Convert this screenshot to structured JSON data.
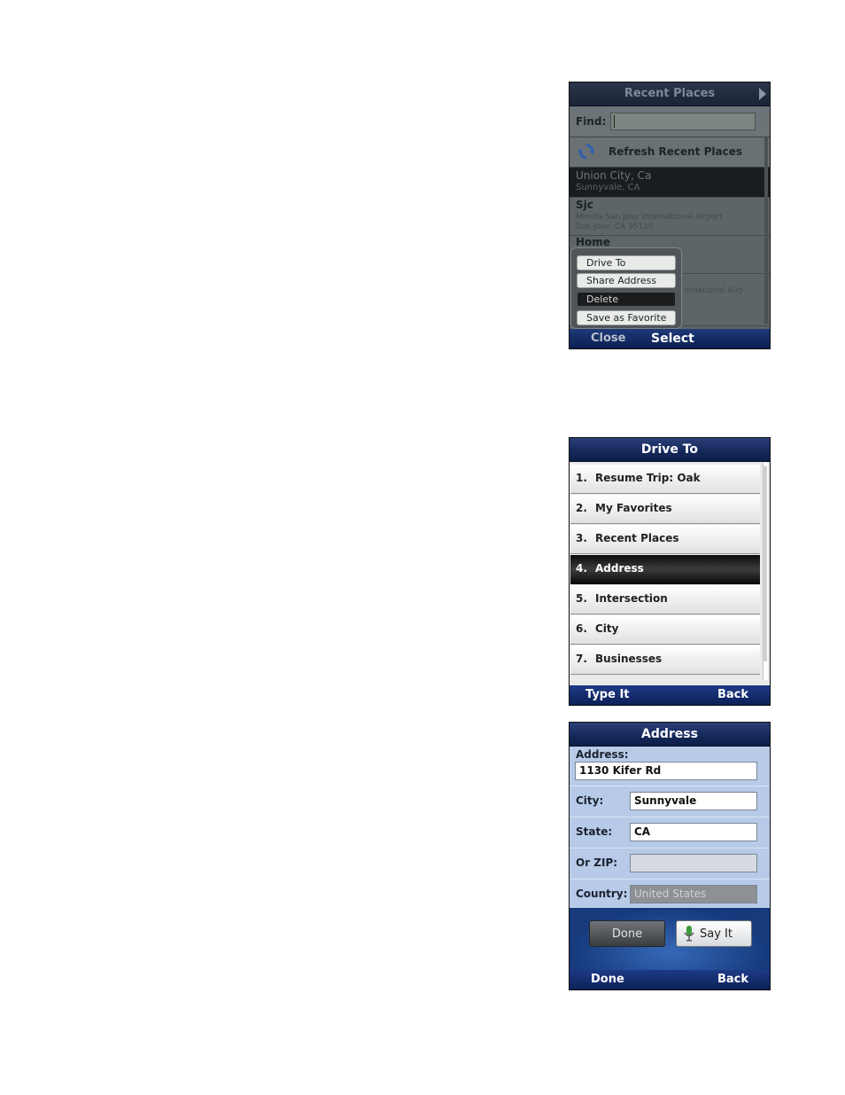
{
  "recent_places": {
    "title": "Recent Places",
    "find_label": "Find:",
    "find_value": "",
    "refresh_label": "Refresh Recent Places",
    "items": [
      {
        "title": "Union City, Ca",
        "sub1": "Sunnyvale, CA",
        "sub2": ""
      },
      {
        "title": "Sjc",
        "sub1": "Mineta San Jose International Airport",
        "sub2": "San Jose, CA 95110"
      },
      {
        "title": "Home",
        "sub1": "",
        "sub2": ""
      },
      {
        "title": "",
        "sub1": "ernational Airp..",
        "sub2": ""
      }
    ],
    "popup_options": [
      "Drive To",
      "Share Address",
      "Delete",
      "Save as Favorite"
    ],
    "popup_selected_index": 2,
    "softkey_left": "Close",
    "softkey_right": "Select"
  },
  "drive_to": {
    "title": "Drive To",
    "items": [
      {
        "num": "1.",
        "label": "Resume Trip: Oak"
      },
      {
        "num": "2.",
        "label": "My Favorites"
      },
      {
        "num": "3.",
        "label": "Recent Places"
      },
      {
        "num": "4.",
        "label": "Address"
      },
      {
        "num": "5.",
        "label": "Intersection"
      },
      {
        "num": "6.",
        "label": "City"
      },
      {
        "num": "7.",
        "label": "Businesses"
      }
    ],
    "selected_index": 3,
    "softkey_left": "Type It",
    "softkey_right": "Back"
  },
  "address": {
    "title": "Address",
    "address_label": "Address:",
    "address_value": "1130 Kifer Rd",
    "city_label": "City:",
    "city_value": "Sunnyvale",
    "state_label": "State:",
    "state_value": "CA",
    "zip_label": "Or ZIP:",
    "zip_value": "",
    "country_label": "Country:",
    "country_value": "United States",
    "done_button": "Done",
    "sayit_button": "Say It",
    "softkey_left": "Done",
    "softkey_right": "Back"
  }
}
